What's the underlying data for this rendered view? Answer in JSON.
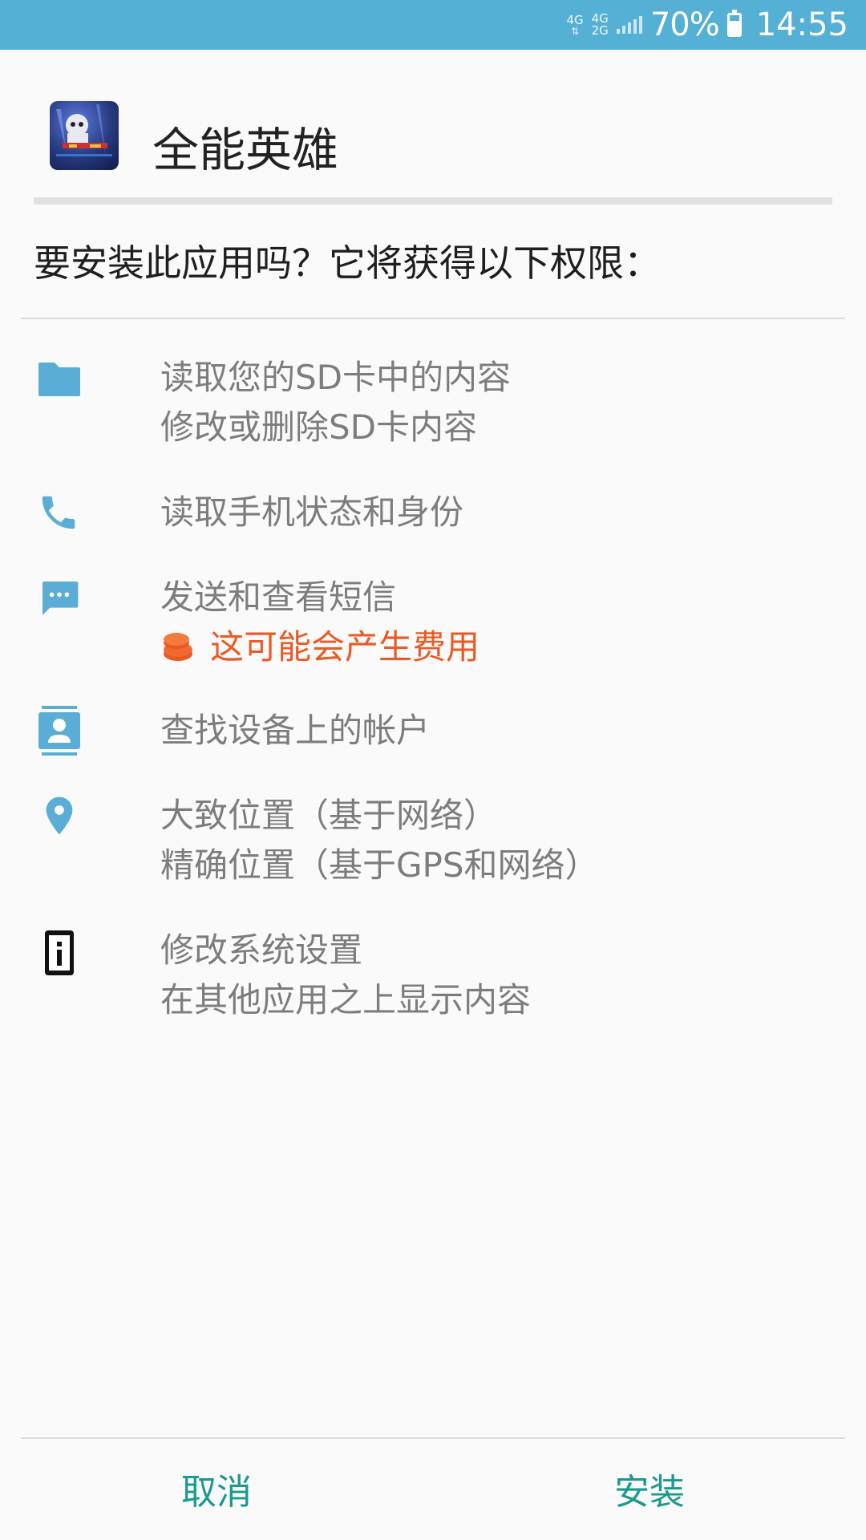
{
  "status_bar": {
    "net1": "4G",
    "net2_top": "4G",
    "net2_bottom": "2G",
    "battery_pct": "70%",
    "time": "14:55"
  },
  "app": {
    "name": "全能英雄"
  },
  "prompt": "要安装此应用吗？它将获得以下权限：",
  "permissions": [
    {
      "icon": "folder-icon",
      "lines": [
        "读取您的SD卡中的内容",
        "修改或删除SD卡内容"
      ]
    },
    {
      "icon": "phone-icon",
      "lines": [
        "读取手机状态和身份"
      ]
    },
    {
      "icon": "message-icon",
      "lines": [
        "发送和查看短信"
      ],
      "warning": "这可能会产生费用"
    },
    {
      "icon": "contact-icon",
      "lines": [
        "查找设备上的帐户"
      ]
    },
    {
      "icon": "location-pin-icon",
      "lines": [
        "大致位置（基于网络）",
        "精确位置（基于GPS和网络）"
      ]
    },
    {
      "icon": "system-settings-icon",
      "lines": [
        "修改系统设置",
        "在其他应用之上显示内容"
      ]
    }
  ],
  "buttons": {
    "cancel": "取消",
    "install": "安装"
  },
  "colors": {
    "status_bar": "#55b0d6",
    "icon": "#5aaed6",
    "warning": "#ea5a25",
    "button_text": "#1a9a8f"
  }
}
